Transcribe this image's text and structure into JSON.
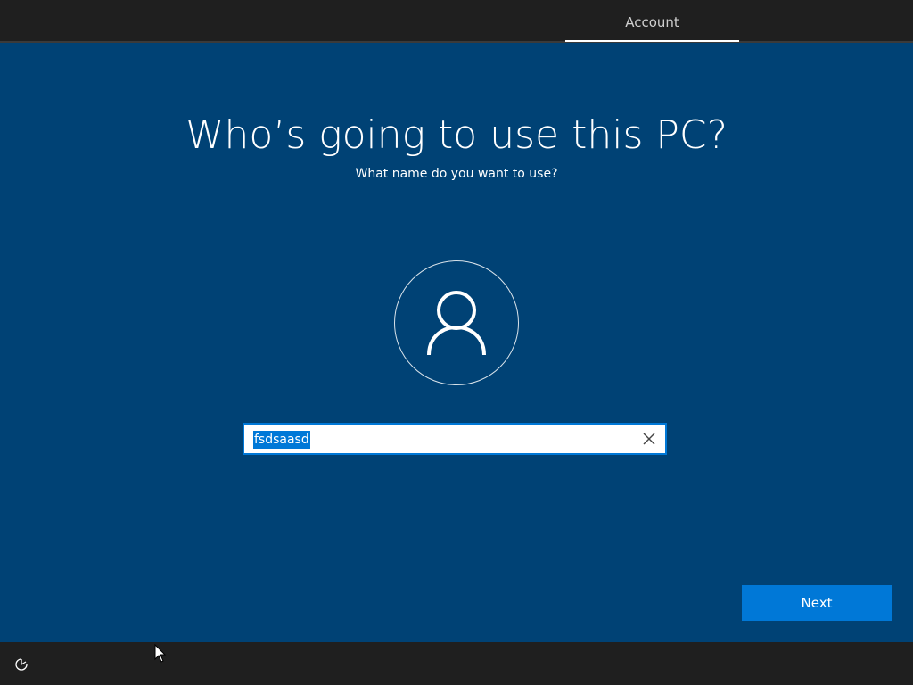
{
  "header": {
    "tabs": [
      {
        "label": "Account",
        "active": true
      }
    ]
  },
  "main": {
    "title": "Who’s going to use this PC?",
    "subtitle": "What name do you want to use?",
    "avatar_icon": "user-icon",
    "name_field": {
      "value": "fsdsaasd",
      "selected": true,
      "clear_icon": "close-icon"
    },
    "next_label": "Next"
  },
  "footer": {
    "ease_of_access_icon": "ease-of-access-icon"
  },
  "colors": {
    "background": "#004275",
    "bars": "#1f1f1f",
    "accent": "#0078d7",
    "text": "#ffffff"
  }
}
